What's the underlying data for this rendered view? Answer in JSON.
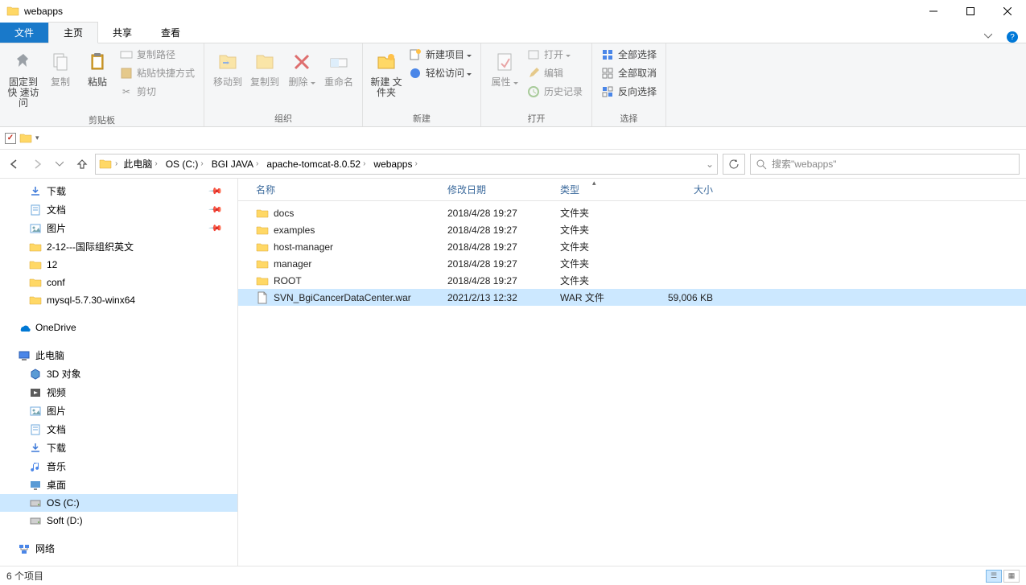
{
  "window": {
    "title": "webapps"
  },
  "tabs": {
    "file": "文件",
    "home": "主页",
    "share": "共享",
    "view": "查看"
  },
  "ribbon": {
    "pin": "固定到快\n速访问",
    "copy": "复制",
    "paste": "粘贴",
    "copy_path": "复制路径",
    "paste_shortcut": "粘贴快捷方式",
    "cut": "剪切",
    "group_clipboard": "剪贴板",
    "move_to": "移动到",
    "copy_to": "复制到",
    "delete": "删除",
    "rename": "重命名",
    "group_organize": "组织",
    "new_folder": "新建\n文件夹",
    "new_item": "新建项目",
    "easy_access": "轻松访问",
    "group_new": "新建",
    "properties": "属性",
    "open": "打开",
    "edit": "编辑",
    "history": "历史记录",
    "group_open": "打开",
    "select_all": "全部选择",
    "select_none": "全部取消",
    "invert_select": "反向选择",
    "group_select": "选择"
  },
  "breadcrumbs": [
    "此电脑",
    "OS (C:)",
    "BGI JAVA",
    "apache-tomcat-8.0.52",
    "webapps"
  ],
  "search_placeholder": "搜索\"webapps\"",
  "tree": [
    {
      "icon": "download",
      "label": "下载",
      "lvl": 2,
      "pin": true
    },
    {
      "icon": "doc",
      "label": "文档",
      "lvl": 2,
      "pin": true
    },
    {
      "icon": "pic",
      "label": "图片",
      "lvl": 2,
      "pin": true
    },
    {
      "icon": "folder",
      "label": "2-12---国际组织英文",
      "lvl": 2
    },
    {
      "icon": "folder",
      "label": "12",
      "lvl": 2
    },
    {
      "icon": "folder",
      "label": "conf",
      "lvl": 2
    },
    {
      "icon": "folder",
      "label": "mysql-5.7.30-winx64",
      "lvl": 2
    },
    {
      "gap": true
    },
    {
      "icon": "onedrive",
      "label": "OneDrive",
      "lvl": 1
    },
    {
      "gap": true
    },
    {
      "icon": "pc",
      "label": "此电脑",
      "lvl": 1
    },
    {
      "icon": "3d",
      "label": "3D 对象",
      "lvl": 2
    },
    {
      "icon": "video",
      "label": "视频",
      "lvl": 2
    },
    {
      "icon": "pic",
      "label": "图片",
      "lvl": 2
    },
    {
      "icon": "doc",
      "label": "文档",
      "lvl": 2
    },
    {
      "icon": "download",
      "label": "下载",
      "lvl": 2
    },
    {
      "icon": "music",
      "label": "音乐",
      "lvl": 2
    },
    {
      "icon": "desktop",
      "label": "桌面",
      "lvl": 2
    },
    {
      "icon": "disk",
      "label": "OS (C:)",
      "lvl": 2,
      "selected": true
    },
    {
      "icon": "disk",
      "label": "Soft (D:)",
      "lvl": 2
    },
    {
      "gap": true
    },
    {
      "icon": "network",
      "label": "网络",
      "lvl": 1
    }
  ],
  "columns": {
    "name": "名称",
    "modified": "修改日期",
    "type": "类型",
    "size": "大小"
  },
  "files": [
    {
      "icon": "folder",
      "name": "docs",
      "modified": "2018/4/28 19:27",
      "type": "文件夹",
      "size": ""
    },
    {
      "icon": "folder",
      "name": "examples",
      "modified": "2018/4/28 19:27",
      "type": "文件夹",
      "size": ""
    },
    {
      "icon": "folder",
      "name": "host-manager",
      "modified": "2018/4/28 19:27",
      "type": "文件夹",
      "size": ""
    },
    {
      "icon": "folder",
      "name": "manager",
      "modified": "2018/4/28 19:27",
      "type": "文件夹",
      "size": ""
    },
    {
      "icon": "folder",
      "name": "ROOT",
      "modified": "2018/4/28 19:27",
      "type": "文件夹",
      "size": ""
    },
    {
      "icon": "file",
      "name": "SVN_BgiCancerDataCenter.war",
      "modified": "2021/2/13 12:32",
      "type": "WAR 文件",
      "size": "59,006 KB",
      "selected": true
    }
  ],
  "status": "6 个项目"
}
